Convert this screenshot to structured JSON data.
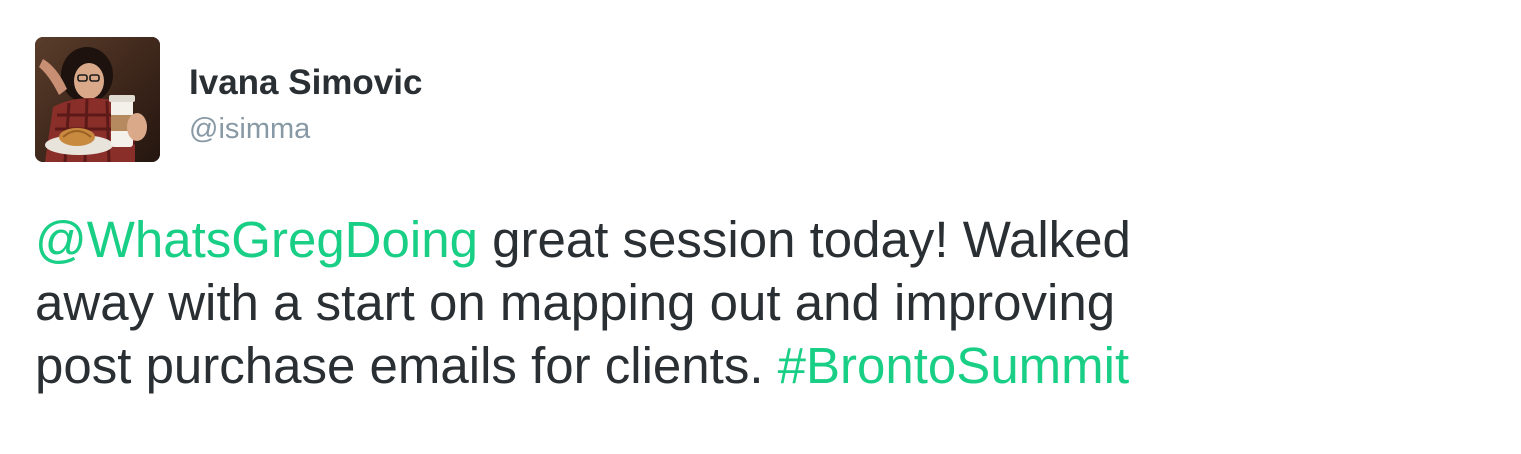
{
  "author": {
    "name": "Ivana Simovic",
    "handle": "@isimma",
    "avatar_icon": "profile-photo"
  },
  "tweet": {
    "lines": [
      [
        {
          "type": "mention",
          "text": "@WhatsGregDoing"
        },
        {
          "type": "text",
          "text": " great session today! Walked"
        }
      ],
      [
        {
          "type": "text",
          "text": "away with a start on mapping out and improving"
        }
      ],
      [
        {
          "type": "text",
          "text": "post purchase emails for clients. "
        },
        {
          "type": "hashtag",
          "text": "#BrontoSummit"
        }
      ]
    ]
  },
  "colors": {
    "link": "#19cf86",
    "text": "#292f33",
    "handle": "#8899a6"
  }
}
